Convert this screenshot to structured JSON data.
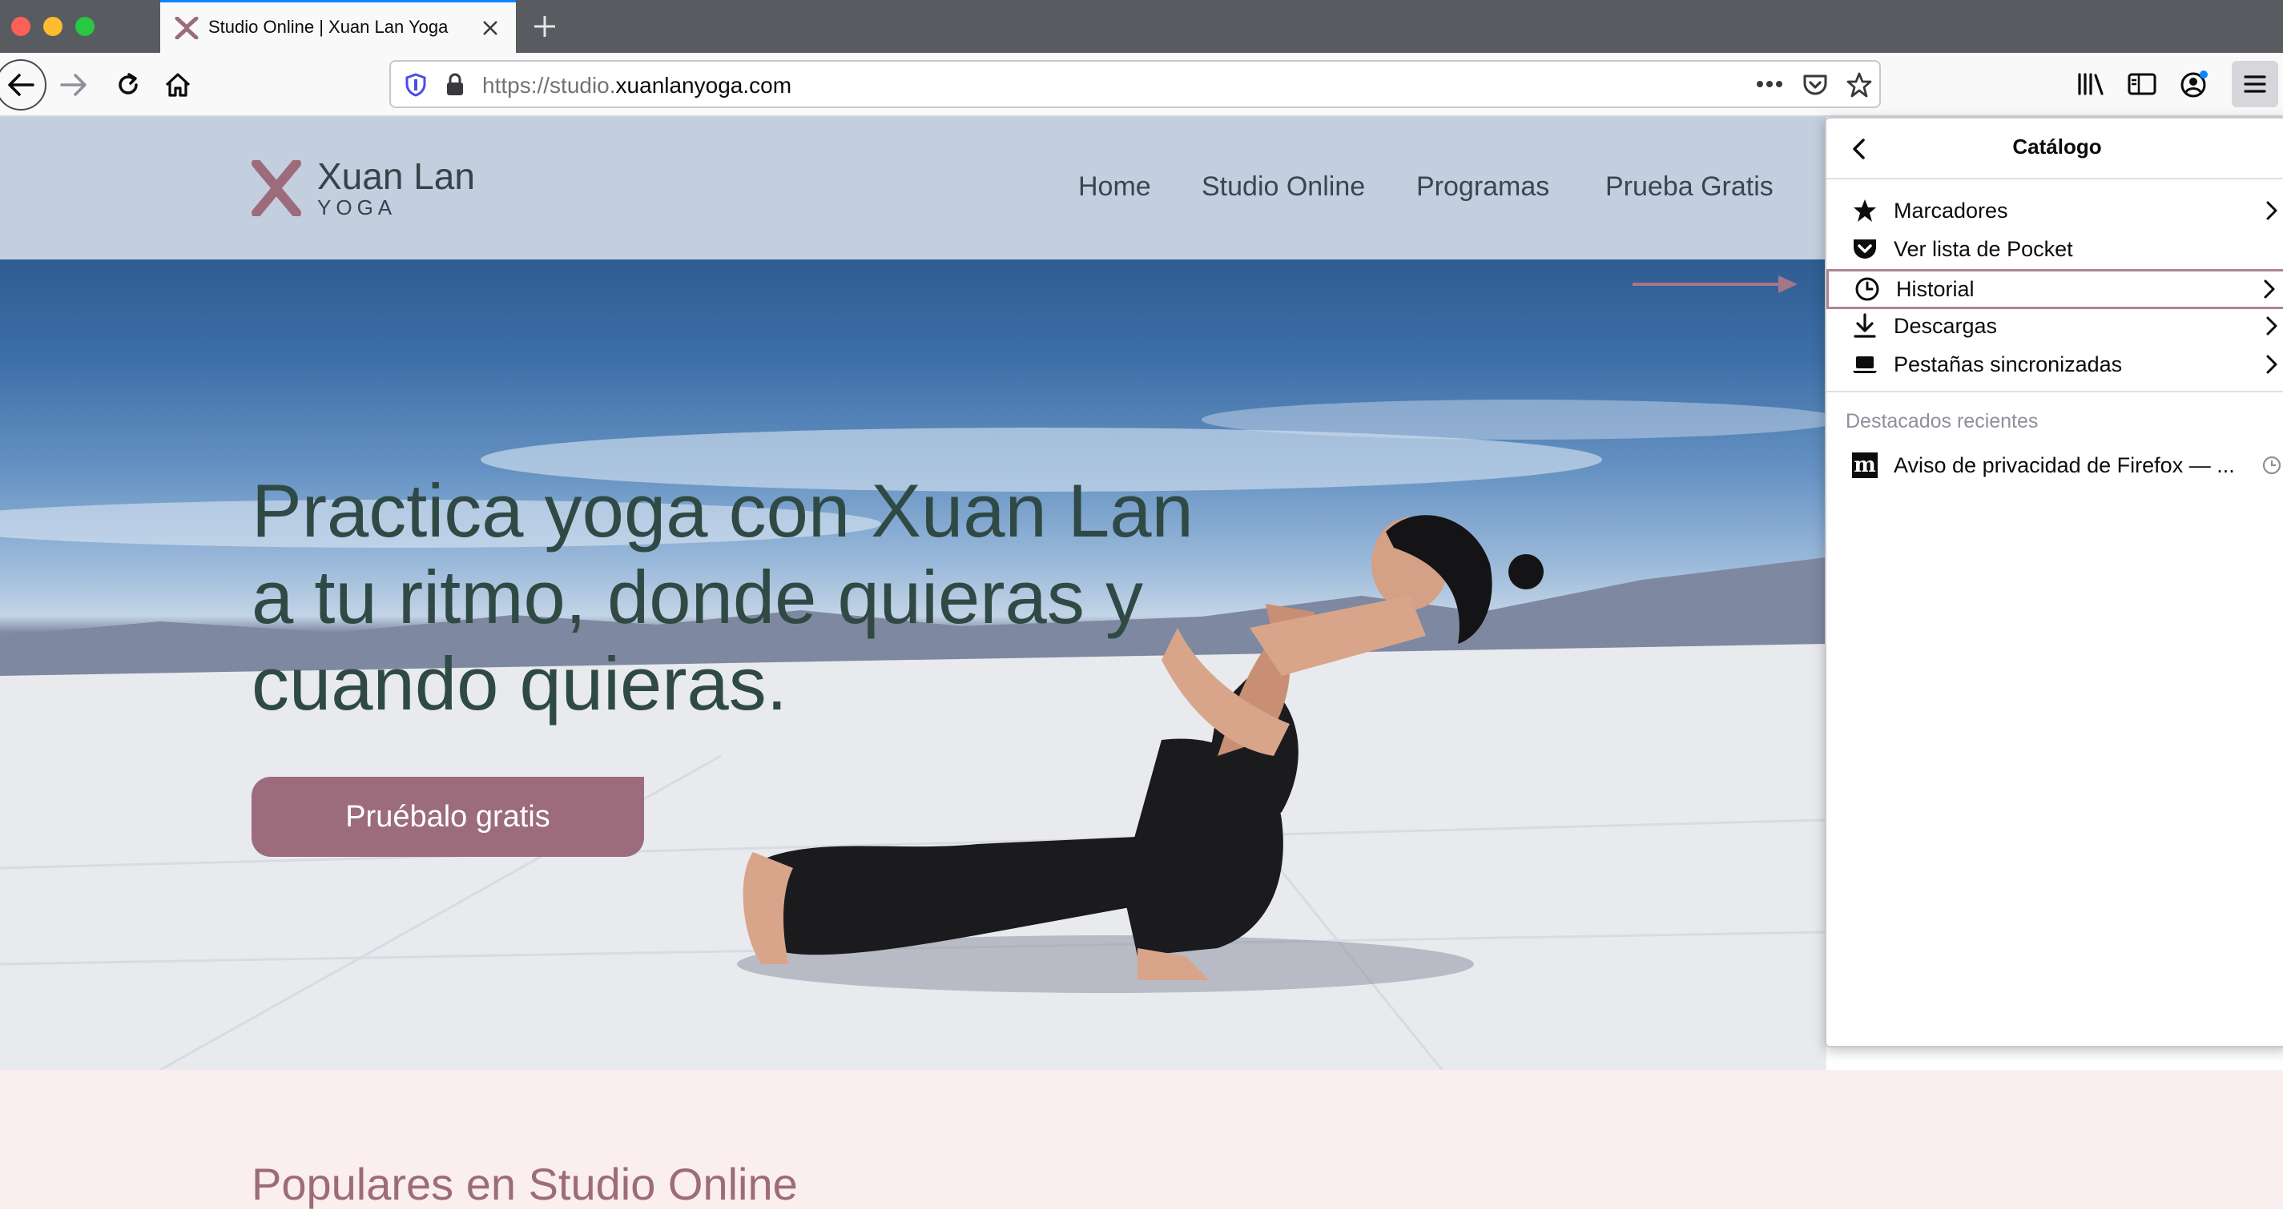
{
  "browser": {
    "tab": {
      "title": "Studio Online | Xuan Lan Yoga"
    },
    "url": {
      "prefix": "https://studio.",
      "domain": "xuanlanyoga.com"
    }
  },
  "site": {
    "logo": {
      "name": "Xuan Lan",
      "sub": "YOGA"
    },
    "nav": [
      {
        "label": "Home"
      },
      {
        "label": "Studio Online"
      },
      {
        "label": "Programas"
      },
      {
        "label": "Prueba Gratis"
      }
    ],
    "hero": {
      "line1": "Practica yoga con Xuan Lan",
      "line2": "a tu ritmo, donde quieras y",
      "line3": "cuando quieras.",
      "cta": "Pruébalo gratis"
    },
    "section_title": "Populares en Studio Online"
  },
  "menu_panel": {
    "title": "Catálogo",
    "items": [
      {
        "label": "Marcadores",
        "icon": "star-icon"
      },
      {
        "label": "Ver lista de Pocket",
        "icon": "pocket-icon"
      },
      {
        "label": "Historial",
        "icon": "clock-icon"
      },
      {
        "label": "Descargas",
        "icon": "download-icon"
      },
      {
        "label": "Pestañas sincronizadas",
        "icon": "synced-tabs-icon"
      }
    ],
    "recent_header": "Destacados recientes",
    "recent_item": "Aviso de privacidad de Firefox — ..."
  },
  "colors": {
    "accent": "#9c6b7c",
    "hero_text": "#2f4a45",
    "highlight_border": "#b08592",
    "firefox_blue": "#0a84ff"
  }
}
